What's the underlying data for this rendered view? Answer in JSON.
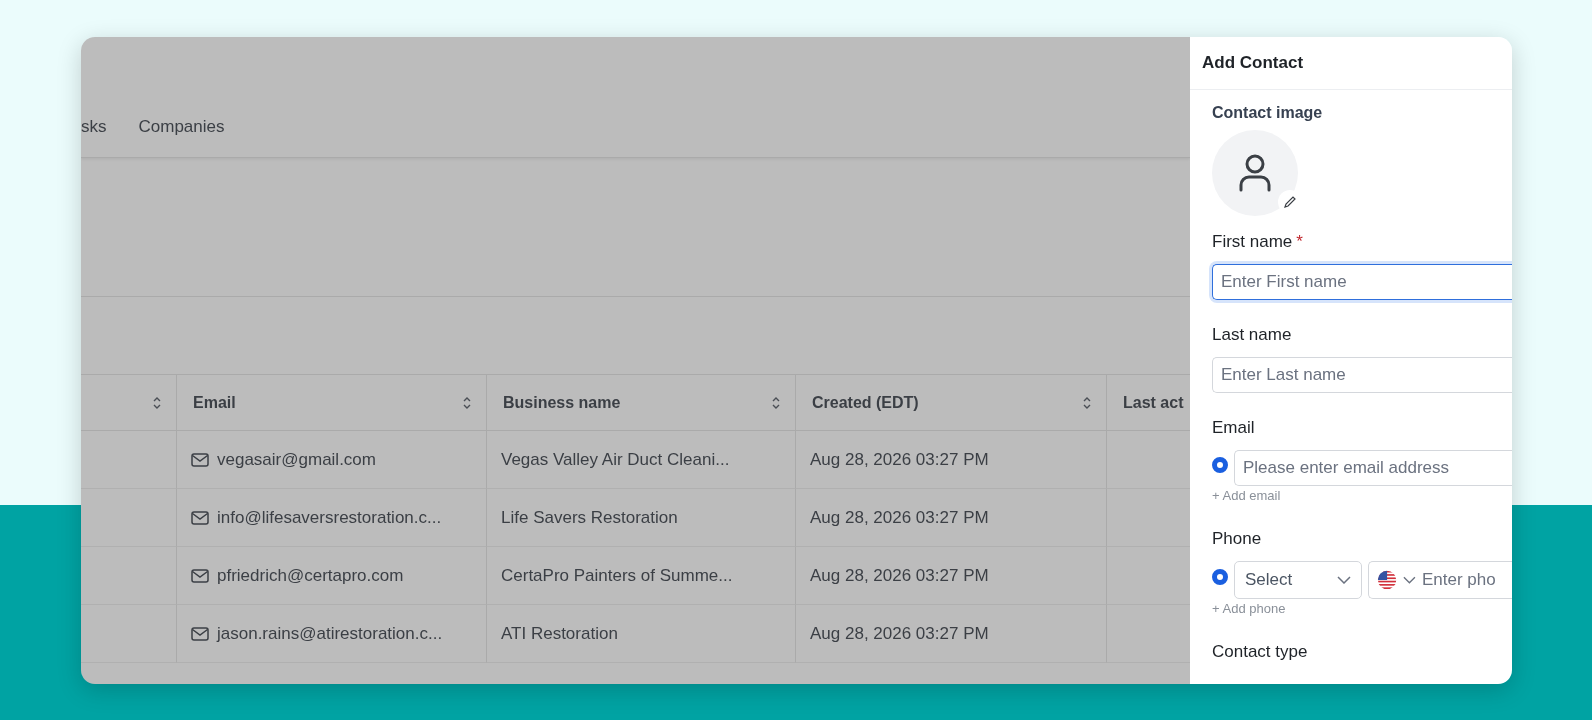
{
  "tabs": [
    {
      "label": "sks",
      "selected": false
    },
    {
      "label": "Companies",
      "selected": false
    }
  ],
  "table": {
    "columns": [
      {
        "sortable": true
      },
      {
        "label": "Email",
        "sortable": true
      },
      {
        "label": "Business name",
        "sortable": true
      },
      {
        "label": "Created (EDT)",
        "sortable": true
      },
      {
        "label": "Last act",
        "sortable": false
      }
    ],
    "rows": [
      {
        "email": "vegasair@gmail.com",
        "business_name": "Vegas Valley Air Duct Cleani...",
        "created": "Aug 28, 2026 03:27 PM"
      },
      {
        "email": "info@lifesaversrestoration.c...",
        "business_name": "Life Savers Restoration",
        "created": "Aug 28, 2026 03:27 PM"
      },
      {
        "email": "pfriedrich@certapro.com",
        "business_name": "CertaPro Painters of Summe...",
        "created": "Aug 28, 2026 03:27 PM"
      },
      {
        "email": "jason.rains@atirestoration.c...",
        "business_name": "ATI Restoration",
        "created": "Aug 28, 2026 03:27 PM"
      }
    ]
  },
  "drawer": {
    "title": "Add Contact",
    "image_label": "Contact image",
    "fields": [
      {
        "kind": "text",
        "label": "First name",
        "required_mark": "*",
        "placeholder": "Enter First name",
        "focused": true
      },
      {
        "kind": "text",
        "label": "Last name",
        "placeholder": "Enter Last name",
        "focused": false
      },
      {
        "kind": "email",
        "label": "Email",
        "primary": true,
        "placeholder": "Please enter email address",
        "add_link": "+ Add email"
      },
      {
        "kind": "phone",
        "label": "Phone",
        "primary": true,
        "type_placeholder": "Select",
        "placeholder": "Enter pho",
        "add_link": "+ Add phone"
      },
      {
        "kind": "section",
        "label": "Contact type"
      }
    ]
  }
}
